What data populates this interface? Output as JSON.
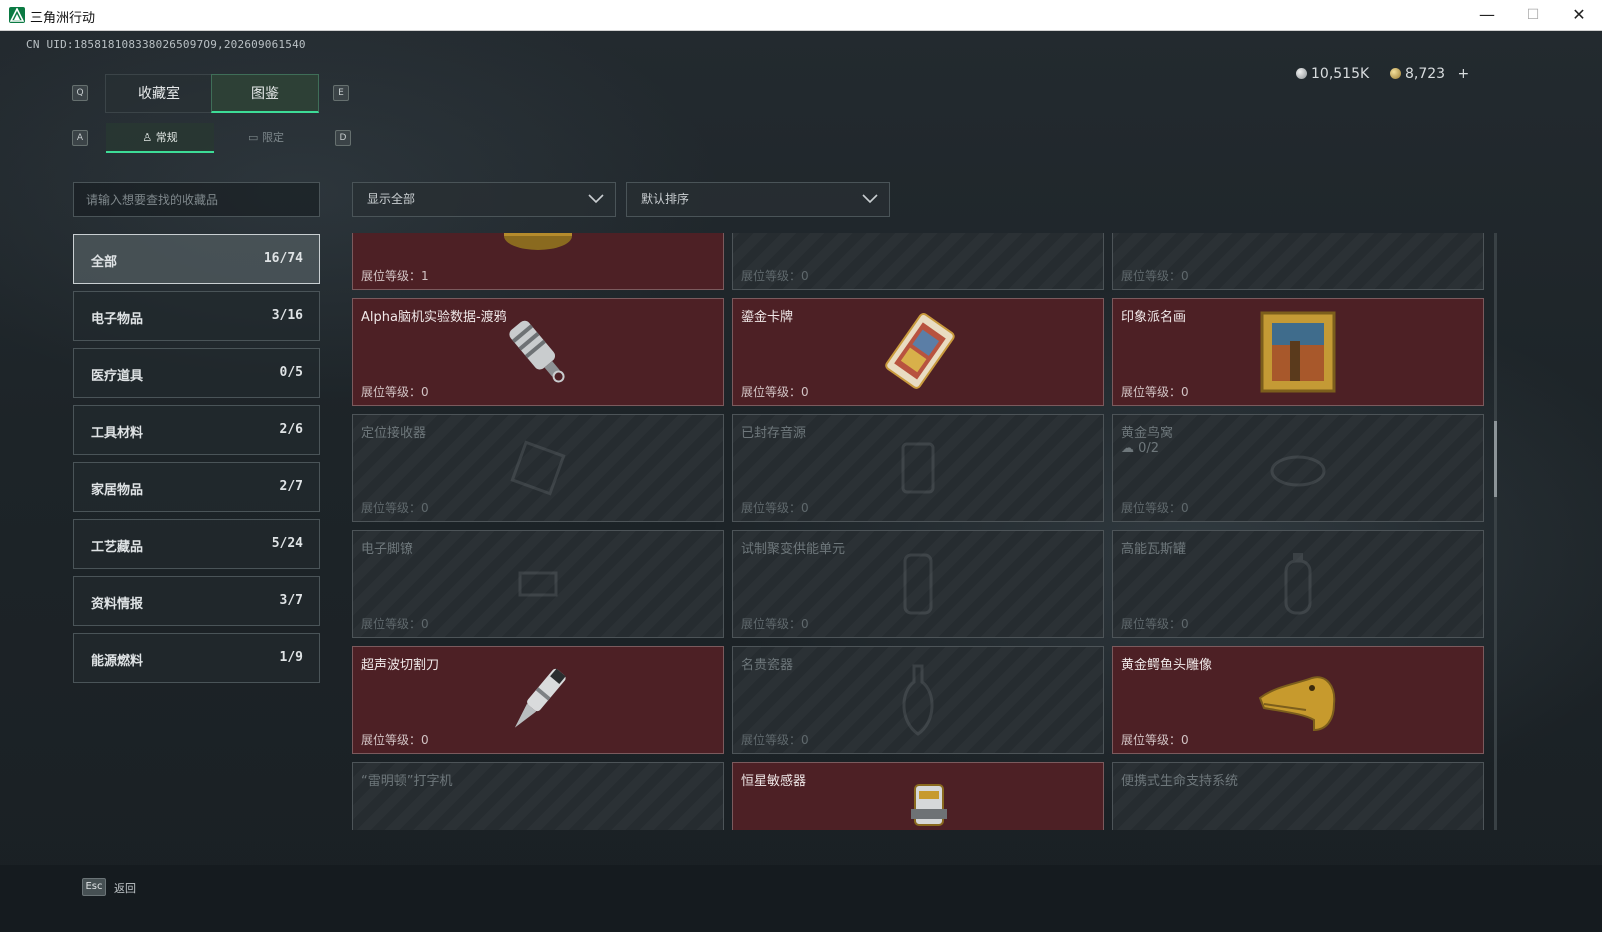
{
  "window": {
    "title": "三角洲行动",
    "min": "—",
    "max": "☐",
    "close": "✕"
  },
  "uid": "CN UID:1858181083380265097O9,202609061540",
  "currency": {
    "silver": "10,515K",
    "gold": "8,723",
    "add": "+"
  },
  "tabs": {
    "key_prev": "Q",
    "key_next": "E",
    "collection_room": "收藏室",
    "catalog": "图鉴"
  },
  "subtabs": {
    "key_prev": "A",
    "key_next": "D",
    "regular": "常规",
    "limited": "限定"
  },
  "search": {
    "placeholder": "请输入想要查找的收藏品"
  },
  "filters": {
    "display": "显示全部",
    "sort": "默认排序"
  },
  "categories": [
    {
      "label": "全部",
      "count": "16/74"
    },
    {
      "label": "电子物品",
      "count": "3/16"
    },
    {
      "label": "医疗道具",
      "count": "0/5"
    },
    {
      "label": "工具材料",
      "count": "2/6"
    },
    {
      "label": "家居物品",
      "count": "2/7"
    },
    {
      "label": "工艺藏品",
      "count": "5/24"
    },
    {
      "label": "资料情报",
      "count": "3/7"
    },
    {
      "label": "能源燃料",
      "count": "1/9"
    }
  ],
  "grid": {
    "row0": [
      {
        "name": "",
        "level": "展位等级：1",
        "state": "owned",
        "icon": "caviar-tin-icon"
      },
      {
        "name": "",
        "level": "展位等级：0",
        "state": "locked",
        "icon": "unknown-item-icon"
      },
      {
        "name": "",
        "level": "展位等级：0",
        "state": "locked",
        "icon": "unknown-item-icon"
      }
    ],
    "row1": [
      {
        "name": "Alpha脑机实验数据-渡鸦",
        "level": "展位等级：0",
        "state": "owned",
        "icon": "data-drive-icon"
      },
      {
        "name": "鎏金卡牌",
        "level": "展位等级：0",
        "state": "owned",
        "icon": "gilded-card-icon"
      },
      {
        "name": "印象派名画",
        "level": "展位等级：0",
        "state": "owned",
        "icon": "painting-icon"
      }
    ],
    "row2": [
      {
        "name": "定位接收器",
        "level": "展位等级：0",
        "state": "locked",
        "icon": "receiver-icon"
      },
      {
        "name": "已封存音源",
        "level": "展位等级：0",
        "state": "locked",
        "icon": "audio-source-icon"
      },
      {
        "name": "黄金鸟窝",
        "sub": "0/2",
        "level": "展位等级：0",
        "state": "locked",
        "icon": "bird-nest-icon"
      }
    ],
    "row3": [
      {
        "name": "电子脚镣",
        "level": "展位等级：0",
        "state": "locked",
        "icon": "ankle-monitor-icon"
      },
      {
        "name": "试制聚变供能单元",
        "level": "展位等级：0",
        "state": "locked",
        "icon": "fusion-cell-icon"
      },
      {
        "name": "高能瓦斯罐",
        "level": "展位等级：0",
        "state": "locked",
        "icon": "gas-canister-icon"
      }
    ],
    "row4": [
      {
        "name": "超声波切割刀",
        "level": "展位等级：0",
        "state": "owned",
        "icon": "ultrasonic-knife-icon"
      },
      {
        "name": "名贵瓷器",
        "level": "展位等级：0",
        "state": "locked",
        "icon": "vase-icon"
      },
      {
        "name": "黄金鳄鱼头雕像",
        "level": "展位等级：0",
        "state": "owned",
        "icon": "gold-crocodile-icon"
      }
    ],
    "row5": [
      {
        "name": "“雷明顿”打字机",
        "level": "",
        "state": "locked",
        "icon": "typewriter-icon"
      },
      {
        "name": "恒星敏感器",
        "level": "",
        "state": "owned",
        "icon": "star-sensor-icon"
      },
      {
        "name": "便携式生命支持系统",
        "level": "",
        "state": "locked",
        "icon": "life-support-icon"
      }
    ]
  },
  "footer": {
    "esc_key": "Esc",
    "esc_label": "返回"
  },
  "colors": {
    "accent": "#3ddc97",
    "owned_card": "#4d2025",
    "locked_card": "#262c30"
  }
}
